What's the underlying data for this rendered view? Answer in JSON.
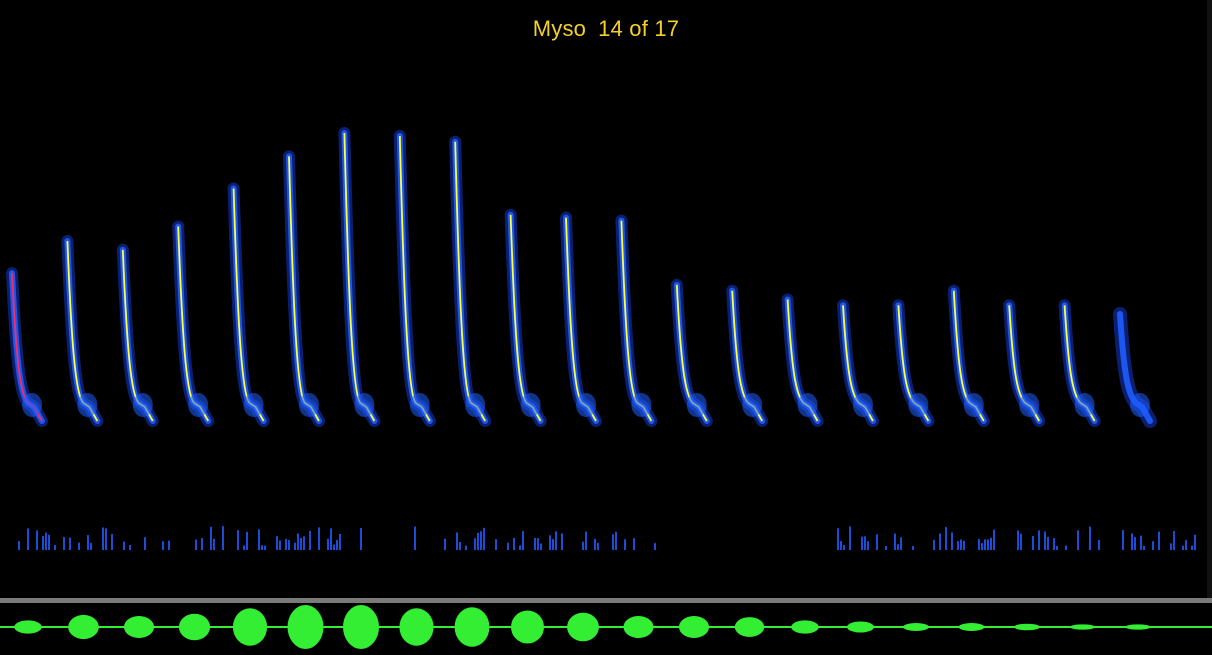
{
  "header": {
    "species": "Myso",
    "counter": "14 of 17"
  },
  "colors": {
    "background": "#000000",
    "title": "#f4d12a",
    "contour_main": "#ffff33",
    "contour_selected": "#ff2a5a",
    "spectrogram_core": "#1e5cff",
    "spectrogram_halo": "#1538c8",
    "waveform": "#33ee33",
    "divider": "#7a7a7a"
  },
  "syllables": {
    "count": 21,
    "selected_index": 0,
    "peak_frequency_levels": [
      0.52,
      0.63,
      0.6,
      0.68,
      0.81,
      0.92,
      1.0,
      0.99,
      0.97,
      0.72,
      0.71,
      0.7,
      0.48,
      0.46,
      0.43,
      0.41,
      0.41,
      0.46,
      0.41,
      0.41,
      0.38
    ]
  },
  "waveform": {
    "relative_amplitudes": [
      0.3,
      0.55,
      0.5,
      0.6,
      0.85,
      1.0,
      1.0,
      0.85,
      0.9,
      0.75,
      0.65,
      0.5,
      0.5,
      0.45,
      0.3,
      0.25,
      0.18,
      0.18,
      0.15,
      0.12,
      0.12
    ]
  }
}
